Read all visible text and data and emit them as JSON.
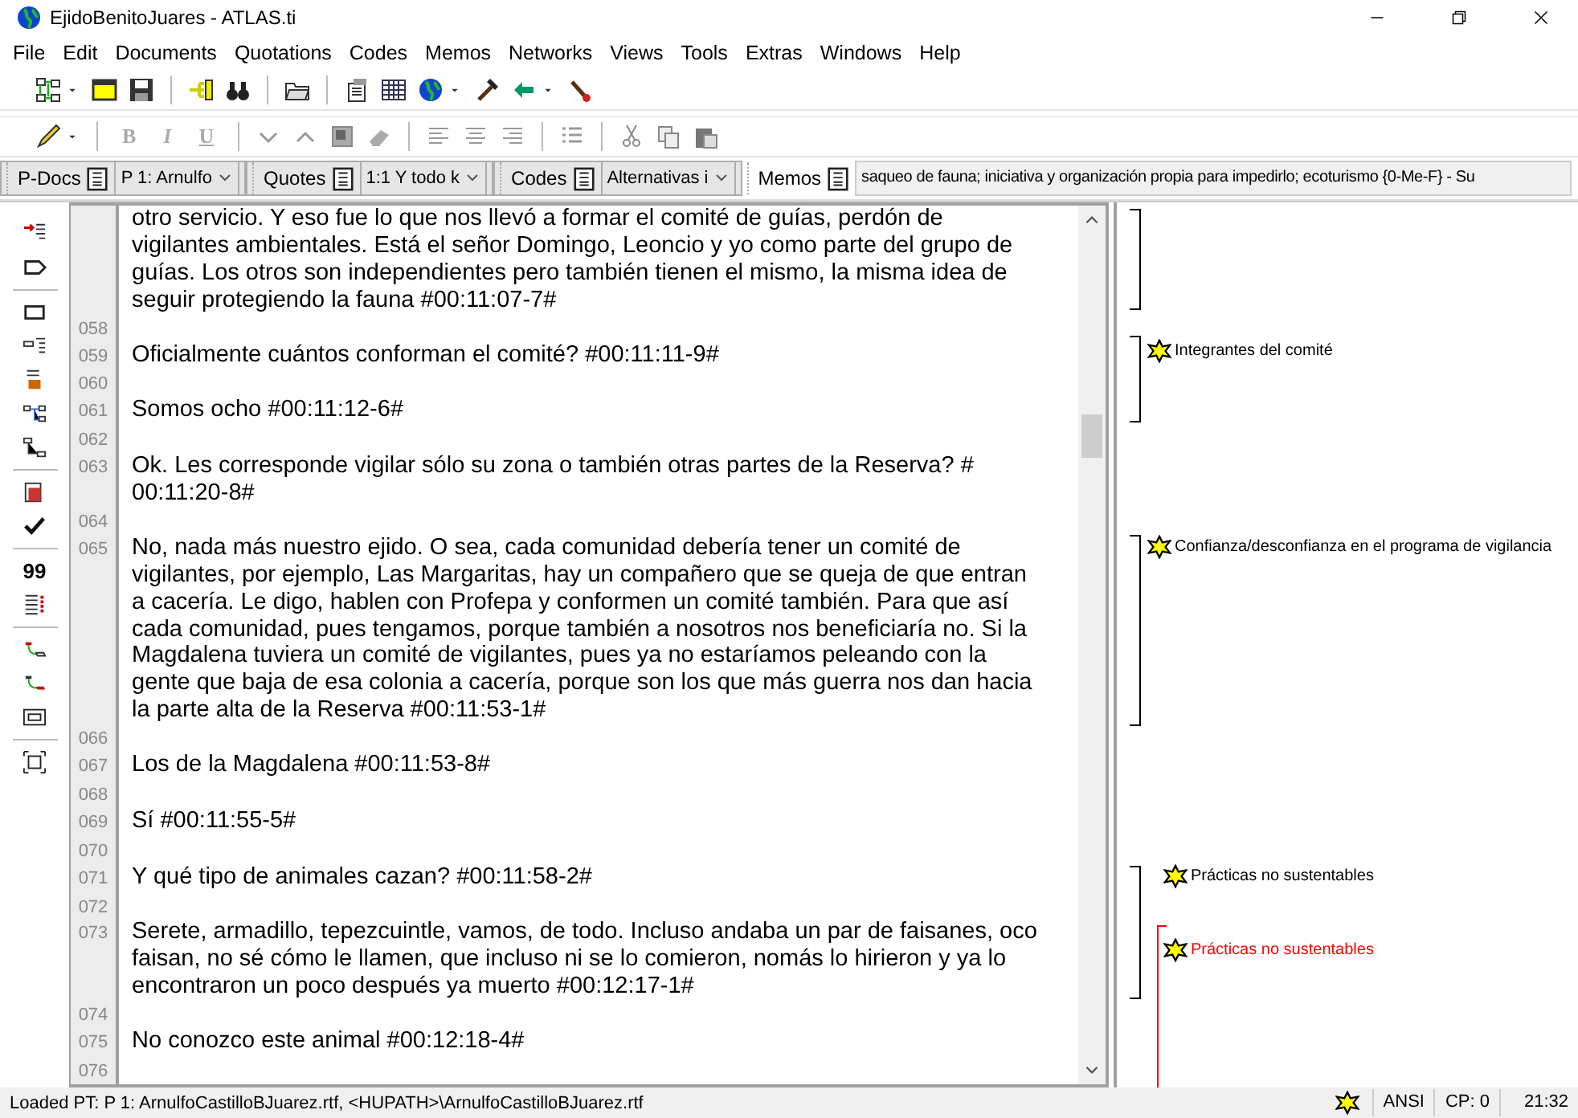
{
  "window": {
    "title": "EjidoBenitoJuares - ATLAS.ti"
  },
  "menu": [
    "File",
    "Edit",
    "Documents",
    "Quotations",
    "Codes",
    "Memos",
    "Networks",
    "Views",
    "Tools",
    "Extras",
    "Windows",
    "Help"
  ],
  "format_buttons": [
    {
      "label": "B",
      "disabled": true
    },
    {
      "label": "I",
      "disabled": true
    },
    {
      "label": "U",
      "disabled": true
    }
  ],
  "selectors": [
    {
      "label": "P-Docs",
      "value": "P 1: Arnulfo",
      "kind": "combo"
    },
    {
      "label": "Quotes",
      "value": "1:1 Y todo k",
      "kind": "combo"
    },
    {
      "label": "Codes",
      "value": "Alternativas i",
      "kind": "combo"
    },
    {
      "label": "Memos",
      "value": "saqueo de fauna; iniciativa y organización propia para impedirlo; ecoturismo {0-Me-F} - Su",
      "kind": "field"
    }
  ],
  "left_toolbar": {
    "quote_label": "99"
  },
  "document": [
    {
      "lines": [
        "otro servicio. Y eso fue lo que nos llevó a formar el comité de guías, perdón de",
        "vigilantes ambientales. Está el señor Domingo, Leoncio y yo como parte del grupo de",
        "guías. Los otros son independientes pero también tienen el mismo, la misma idea de",
        "seguir protegiendo la fauna #00:11:07-7#"
      ]
    },
    {
      "number": "058"
    },
    {
      "number": "059",
      "lines": [
        "Oficialmente cuántos conforman el comité? #00:11:11-9#"
      ]
    },
    {
      "number": "060"
    },
    {
      "number": "061",
      "lines": [
        "Somos ocho #00:11:12-6#"
      ]
    },
    {
      "number": "062"
    },
    {
      "number": "063",
      "lines": [
        "Ok. Les corresponde vigilar sólo su zona o también otras partes de la Reserva? #",
        "00:11:20-8#"
      ]
    },
    {
      "number": "064"
    },
    {
      "number": "065",
      "lines": [
        "No, nada más nuestro ejido. O sea, cada comunidad debería tener un comité de",
        "vigilantes, por ejemplo, Las Margaritas, hay un compañero que se queja de que entran",
        "a cacería. Le digo, hablen con Profepa y conformen un comité también. Para que así",
        "cada comunidad, pues tengamos, porque también a nosotros nos beneficiaría no. Si la",
        "Magdalena tuviera un comité de vigilantes, pues ya no estaríamos peleando con la",
        "gente que baja de esa colonia a cacería, porque son los que más guerra nos dan hacia",
        "la parte alta de la Reserva #00:11:53-1#"
      ]
    },
    {
      "number": "066"
    },
    {
      "number": "067",
      "lines": [
        "Los de la Magdalena #00:11:53-8#"
      ]
    },
    {
      "number": "068"
    },
    {
      "number": "069",
      "lines": [
        "Sí #00:11:55-5#"
      ]
    },
    {
      "number": "070"
    },
    {
      "number": "071",
      "lines": [
        "Y qué tipo de animales cazan? #00:11:58-2#"
      ]
    },
    {
      "number": "072"
    },
    {
      "number": "073",
      "lines": [
        "Serete, armadillo, tepezcuintle, vamos, de todo. Incluso andaba un par de faisanes, oco",
        "faisan, no sé cómo le llamen, que incluso ni se lo comieron, nomás lo hirieron y ya lo",
        "encontraron un poco después ya muerto #00:12:17-1#"
      ]
    },
    {
      "number": "074"
    },
    {
      "number": "075",
      "lines": [
        "No conozco este animal #00:12:18-4#"
      ]
    },
    {
      "number": "076"
    }
  ],
  "codes": [
    {
      "color": "#000000"
    },
    {
      "label": "Integrantes del comité",
      "color": "#000000"
    },
    {
      "label": "Confianza/desconfianza en el programa de vigilancia",
      "color": "#000000"
    },
    {
      "label": "Prácticas no sustentables",
      "color": "#000000"
    },
    {
      "label": "Prácticas no sustentables",
      "color": "#ff0000"
    }
  ],
  "status_bar": {
    "message": "Loaded PT: P 1: ArnulfoCastilloBJuarez.rtf, <HUPATH>\\ArnulfoCastilloBJuarez.rtf",
    "encoding": "ANSI",
    "codepage": "CP: 0",
    "time": "21:32"
  }
}
